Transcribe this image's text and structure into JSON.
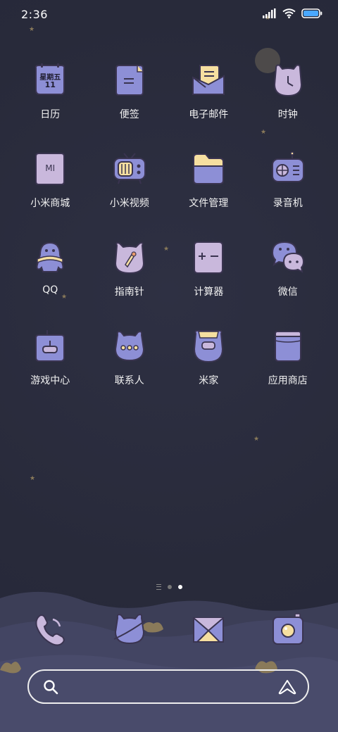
{
  "status_bar": {
    "time": "2:36",
    "icons": [
      "signal-icon",
      "wifi-icon",
      "battery-icon"
    ],
    "battery_level": 1.0
  },
  "calendar_icon": {
    "weekday": "星期五",
    "day": "11"
  },
  "xiaomi_store_icon": {
    "text": "MI"
  },
  "apps": [
    [
      {
        "label": "日历",
        "icon": "calendar-icon"
      },
      {
        "label": "便签",
        "icon": "notes-icon"
      },
      {
        "label": "电子邮件",
        "icon": "email-icon"
      },
      {
        "label": "时钟",
        "icon": "clock-icon"
      }
    ],
    [
      {
        "label": "小米商城",
        "icon": "mi-store-icon"
      },
      {
        "label": "小米视频",
        "icon": "video-icon"
      },
      {
        "label": "文件管理",
        "icon": "folder-icon"
      },
      {
        "label": "录音机",
        "icon": "recorder-icon"
      }
    ],
    [
      {
        "label": "QQ",
        "icon": "qq-icon"
      },
      {
        "label": "指南针",
        "icon": "compass-icon"
      },
      {
        "label": "计算器",
        "icon": "calculator-icon"
      },
      {
        "label": "微信",
        "icon": "wechat-icon"
      }
    ],
    [
      {
        "label": "游戏中心",
        "icon": "game-center-icon"
      },
      {
        "label": "联系人",
        "icon": "contacts-icon"
      },
      {
        "label": "米家",
        "icon": "mijia-icon"
      },
      {
        "label": "应用商店",
        "icon": "app-store-icon"
      }
    ]
  ],
  "pager": {
    "pages": 2,
    "current": 2
  },
  "dock": [
    "phone-icon",
    "browser-icon",
    "messages-icon",
    "camera-icon"
  ],
  "search_bar": {
    "icons": [
      "search-icon",
      "assistant-icon"
    ]
  },
  "colors": {
    "background": "#2a2c3c",
    "icon_purple": "#8d8fd6",
    "icon_lilac": "#c9b8dc",
    "icon_cream": "#f6dfa0",
    "outline": "#3a3450"
  }
}
